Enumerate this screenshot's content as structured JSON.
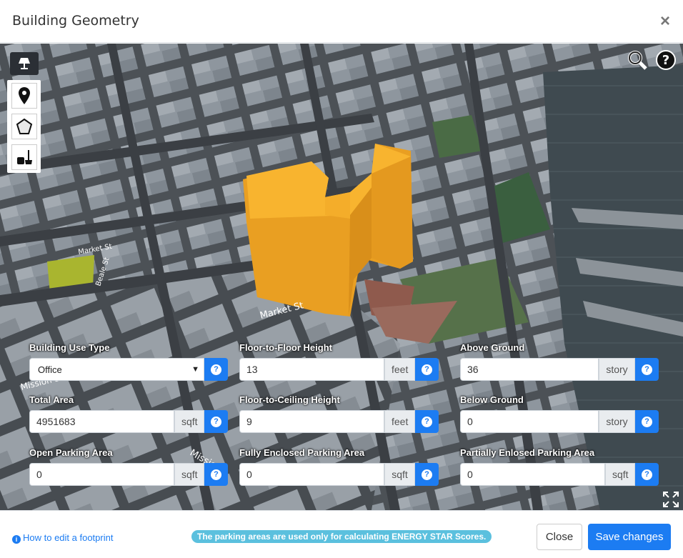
{
  "dialog": {
    "title": "Building Geometry",
    "close_glyph": "×"
  },
  "map": {
    "tools": [
      "lamp-icon",
      "map-pin-icon",
      "polygon-icon",
      "cleanup-icon"
    ],
    "search_icon": "search-icon",
    "help_icon": "help-icon",
    "expand_icon": "fullscreen-icon",
    "street_labels": [
      "Market St",
      "Market St",
      "Beale St",
      "Mission St",
      "Mission"
    ],
    "building_color": "#f0a623"
  },
  "form": {
    "building_use_type": {
      "label": "Building Use Type",
      "value": "Office",
      "help": "?"
    },
    "floor_to_floor_height": {
      "label": "Floor-to-Floor Height",
      "value": "13",
      "unit": "feet",
      "help": "?"
    },
    "above_ground": {
      "label": "Above Ground",
      "value": "36",
      "unit": "story",
      "help": "?"
    },
    "total_area": {
      "label": "Total Area",
      "value": "4951683",
      "unit": "sqft",
      "help": "?"
    },
    "floor_to_ceiling_height": {
      "label": "Floor-to-Ceiling Height",
      "value": "9",
      "unit": "feet",
      "help": "?"
    },
    "below_ground": {
      "label": "Below Ground",
      "value": "0",
      "unit": "story",
      "help": "?"
    },
    "open_parking_area": {
      "label": "Open Parking Area",
      "value": "0",
      "unit": "sqft",
      "help": "?"
    },
    "fully_enclosed_parking_area": {
      "label": "Fully Enclosed Parking Area",
      "value": "0",
      "unit": "sqft",
      "help": "?"
    },
    "partially_enclosed_parking_area": {
      "label": "Partially Enlosed Parking Area",
      "value": "0",
      "unit": "sqft",
      "help": "?"
    }
  },
  "footer": {
    "howto_icon": "i",
    "howto_link": "How to edit a footprint",
    "parking_note": "The parking areas are used only for calculating ENERGY STAR Scores.",
    "close_label": "Close",
    "save_label": "Save changes"
  },
  "colors": {
    "primary": "#1c7cf2",
    "info": "#5bc0de"
  }
}
